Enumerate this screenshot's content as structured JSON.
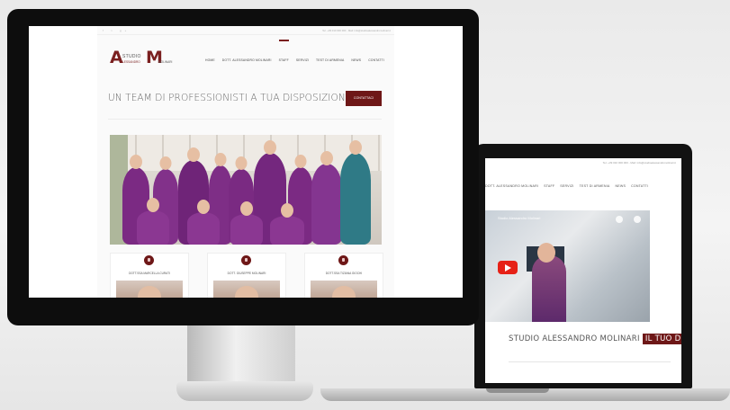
{
  "desktop_site": {
    "topbar": {
      "social_icons": [
        "f",
        "t",
        "g+"
      ],
      "contact_text": "Tel. +39 010 000 000 - Mail: info@studioalessandromolinari.it"
    },
    "logo": {
      "letter_a": "A",
      "letter_m": "M",
      "studio": "STUDIO",
      "name_first": "ALESSANDRO",
      "name_last": "MOLINARI"
    },
    "nav": [
      {
        "label": "HOME",
        "active": false
      },
      {
        "label": "DOTT. ALESSANDRO MOLINARI",
        "active": false
      },
      {
        "label": "STAFF",
        "active": true
      },
      {
        "label": "SERVIZI",
        "active": false
      },
      {
        "label": "TEST DI ARMENIA",
        "active": false
      },
      {
        "label": "NEWS",
        "active": false
      },
      {
        "label": "CONTATTI",
        "active": false
      }
    ],
    "headline": "UN TEAM DI PROFESSIONISTI A TUA DISPOSIZIONE",
    "cta_label": "CONTATTACI",
    "team_cards": [
      {
        "name": "DOTT.SSA MARCELLA CURATI"
      },
      {
        "name": "DOTT. GIUSEPPE MOLINARI"
      },
      {
        "name": "DOTT.SSA TIZIANA GIOCHI"
      }
    ]
  },
  "laptop_site": {
    "topbar_contact": "Tel. +39 010 000 000 - Mail: info@studioalessandromolinari.it",
    "nav": [
      {
        "label": "DOTT. ALESSANDRO MOLINARI",
        "active": false
      },
      {
        "label": "STAFF",
        "active": false
      },
      {
        "label": "SERVIZI",
        "active": false
      },
      {
        "label": "TEST DI ARMENIA",
        "active": false
      },
      {
        "label": "NEWS",
        "active": false
      },
      {
        "label": "CONTATTI",
        "active": false
      }
    ],
    "video_title": "Studio Alessandro Molinari",
    "tagline_main": "STUDIO ALESSANDRO MOLINARI",
    "tagline_highlight": "IL TUO DENTISTA A GENOVA"
  },
  "colors": {
    "brand": "#6e1717",
    "scrubs": "#7b2a83"
  }
}
